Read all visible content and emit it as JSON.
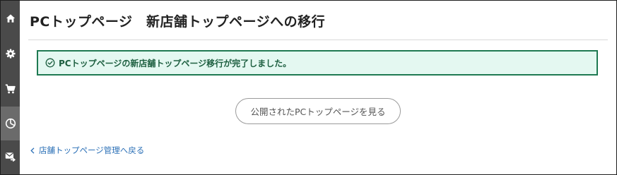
{
  "page": {
    "title": "PCトップページ　新店舗トップページへの移行"
  },
  "sidebar": {
    "items": [
      {
        "icon": "home-icon"
      },
      {
        "icon": "gear-icon"
      },
      {
        "icon": "cart-icon"
      },
      {
        "icon": "pie-chart-icon",
        "active": true
      },
      {
        "icon": "mail-forward-icon"
      }
    ]
  },
  "notice": {
    "icon": "check-circle-icon",
    "message": "PCトップページの新店舗トップページ移行が完了しました。"
  },
  "actions": {
    "view_button_label": "公開されたPCトップページを見る"
  },
  "navigation": {
    "back_link_icon": "chevron-left-icon",
    "back_link_label": "店舗トップページ管理へ戻る"
  },
  "colors": {
    "sidebar_bg": "#4a4a4a",
    "sidebar_active_bg": "#6b6b6b",
    "success_border": "#1f7a52",
    "success_bg": "#e4f8f1",
    "link": "#2a6fb6"
  }
}
